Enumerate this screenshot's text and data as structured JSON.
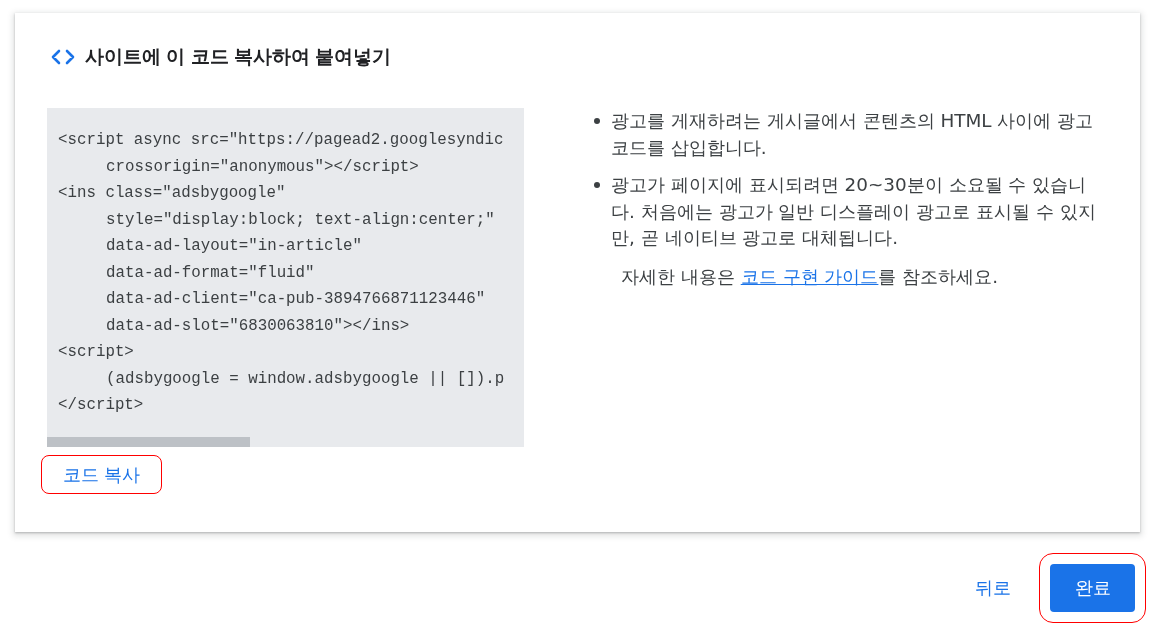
{
  "dialog": {
    "title": "사이트에 이 코드 복사하여 붙여넣기"
  },
  "code": {
    "lines": [
      {
        "text": "<script async src=\"https://pagead2.googlesyndic",
        "indented": false
      },
      {
        "text": "crossorigin=\"anonymous\"></script>",
        "indented": true
      },
      {
        "text": "<ins class=\"adsbygoogle\"",
        "indented": false
      },
      {
        "text": "style=\"display:block; text-align:center;\"",
        "indented": true
      },
      {
        "text": "data-ad-layout=\"in-article\"",
        "indented": true
      },
      {
        "text": "data-ad-format=\"fluid\"",
        "indented": true
      },
      {
        "text": "data-ad-client=\"ca-pub-3894766871123446\"",
        "indented": true
      },
      {
        "text": "data-ad-slot=\"6830063810\"></ins>",
        "indented": true
      },
      {
        "text": "<script>",
        "indented": false
      },
      {
        "text": "(adsbygoogle = window.adsbygoogle || []).p",
        "indented": true
      },
      {
        "text": "</script>",
        "indented": false
      }
    ]
  },
  "copy_button": {
    "label": "코드 복사",
    "highlighted": true
  },
  "notes": {
    "bullets": [
      "광고를 게재하려는 게시글에서 콘텐츠의 HTML 사이에 광고 코드를 삽입합니다.",
      "광고가 페이지에 표시되려면 20~30분이 소요될 수 있습니다. 처음에는 광고가 일반 디스플레이 광고로 표시될 수 있지만, 곧 네이티브 광고로 대체됩니다."
    ],
    "more_info": {
      "before": "자세한 내용은 ",
      "link": "코드 구현 가이드",
      "after": "를 참조하세요."
    }
  },
  "actions": [
    {
      "label": "뒤로",
      "kind": "text",
      "highlighted": false
    },
    {
      "label": "완료",
      "kind": "filled",
      "highlighted": true
    }
  ]
}
